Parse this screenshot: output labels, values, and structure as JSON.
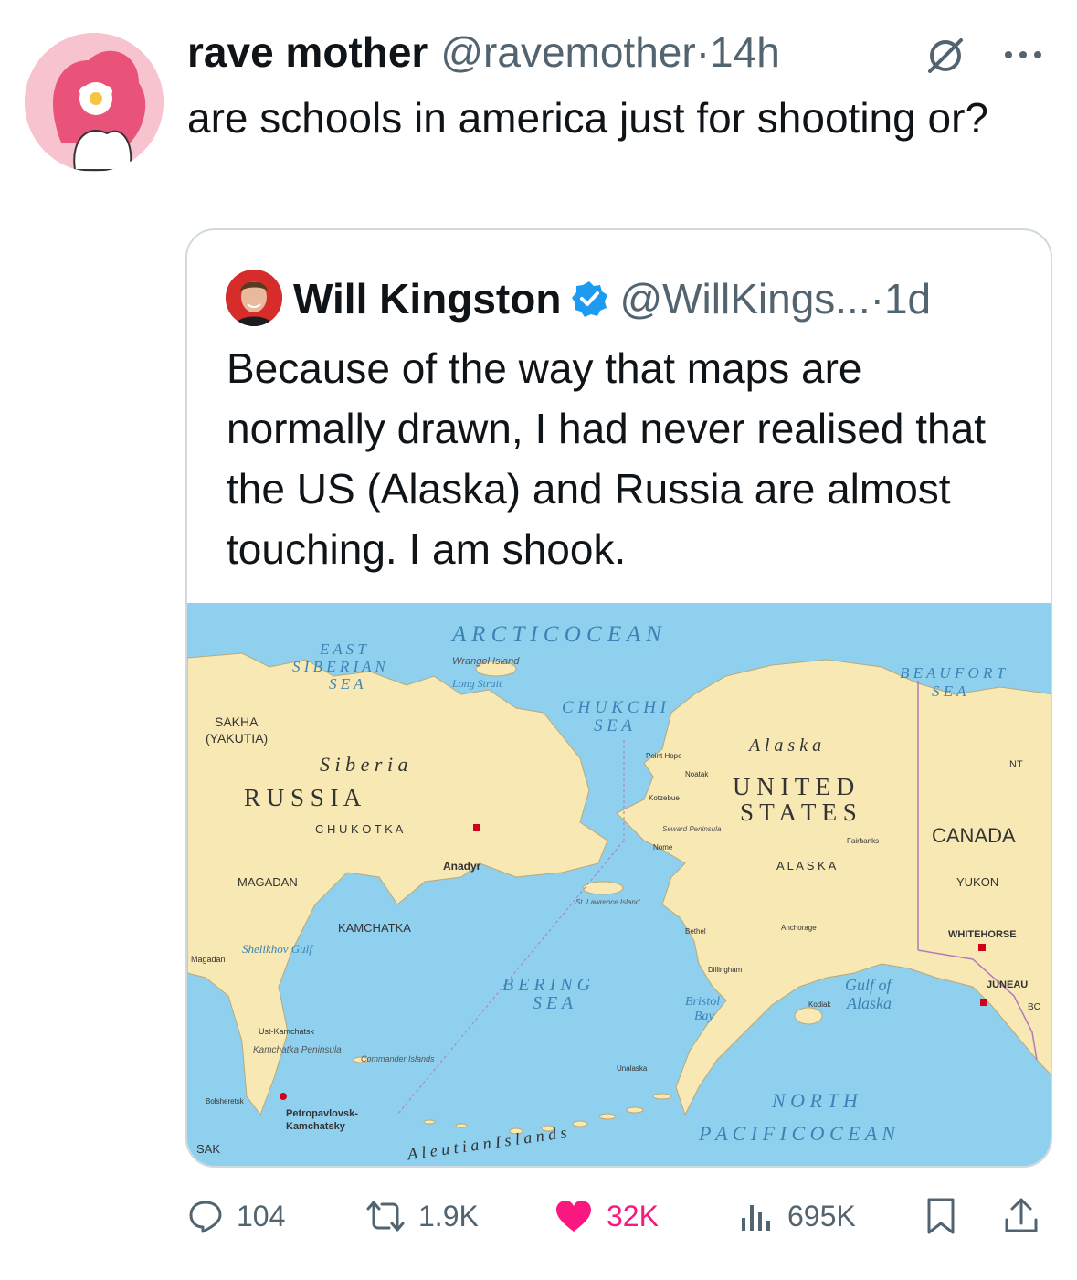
{
  "tweet": {
    "display_name": "rave mother",
    "handle": "@ravemother",
    "separator": " · ",
    "time": "14h",
    "text": "are schools in america just for shooting or?"
  },
  "quoted_tweet": {
    "display_name": "Will Kingston",
    "handle": "@WillKings...",
    "separator": " · ",
    "time": "1d",
    "verified": true,
    "text": "Because of the way that maps are normally drawn, I had never realised that the US (Alaska) and Russia are almost touching. I am shook."
  },
  "map": {
    "labels": {
      "arctic": "A R C T I C   O C E A N",
      "east_siberian_1": "E A S T",
      "east_siberian_2": "S I B E R I A N",
      "east_siberian_3": "S E A",
      "wrangel": "Wrangel Island",
      "long_strait": "Long Strait",
      "beaufort_1": "B E A U F O R T",
      "beaufort_2": "S E A",
      "chukchi_1": "C H U K C H I",
      "chukchi_2": "S E A",
      "sakha_1": "SAKHA",
      "sakha_2": "(YAKUTIA)",
      "siberia": "S i b e r i a",
      "russia": "R  U  S  S  I  A",
      "chukotka": "C H U K O T K A",
      "anadyr": "Anadyr",
      "magadan_region": "MAGADAN",
      "kamchatka_region": "KAMCHATKA",
      "magadan_city": "Magadan",
      "shelikhov": "Shelikhov Gulf",
      "ust_kamchatsk": "Ust-Kamchatsk",
      "kamchatka_peninsula": "Kamchatka Peninsula",
      "commander": "Commander Islands",
      "petropavlovsk_1": "Petropavlovsk-",
      "petropavlovsk_2": "Kamchatsky",
      "sak": "SAK",
      "bolsheretsk": "Bolsheretsk",
      "alaska_region": "A l a s k a",
      "united": "U N I T E D",
      "states": "S T A T E S",
      "alaska_state": "A L A S K A",
      "canada": "CANADA",
      "nt": "NT",
      "yukon": "YUKON",
      "whitehorse": "WHITEHORSE",
      "juneau": "JUNEAU",
      "bc": "BC",
      "gulf_alaska_1": "Gulf of",
      "gulf_alaska_2": "Alaska",
      "bering_1": "B E R I N G",
      "bering_2": "S E A",
      "bristol_1": "Bristol",
      "bristol_2": "Bay",
      "north": "N O R T H",
      "pacific": "P A C I F I C   O C E A N",
      "aleutian": "A l e u t i a n   I s l a n d s",
      "st_lawrence": "St. Lawrence Island",
      "nome": "Nome",
      "fairbanks": "Fairbanks",
      "anchorage": "Anchorage",
      "kodiak": "Kodiak",
      "bethel": "Bethel",
      "kotzebue": "Kotzebue",
      "point_hope": "Point Hope",
      "noatak": "Noatak",
      "seward_peninsula": "Seward Peninsula",
      "unalaska": "Unalaska",
      "dillingham": "Dillingham"
    },
    "colors": {
      "water": "#8fd0ee",
      "land": "#f7e8b4",
      "border": "#b27ab9",
      "capital": "#d0021b"
    }
  },
  "actions": {
    "replies": "104",
    "retweets": "1.9K",
    "likes": "32K",
    "views": "695K"
  }
}
